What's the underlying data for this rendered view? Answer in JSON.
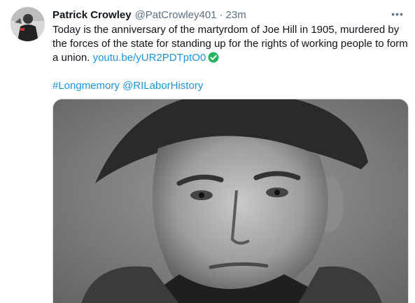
{
  "tweet": {
    "author_name": "Patrick Crowley",
    "handle": "@PatCrowley401",
    "separator": "·",
    "time": "23m",
    "more_label": "•••",
    "text": "Today is the anniversary of the martyrdom of Joe Hill in 1905, murdered by the forces of the state for standing up for the rights of working people to form a union.",
    "link": "youtu.be/yUR2PDTptO0",
    "hashtag": "#Longmemory",
    "mention": "@RILaborHistory",
    "icons": {
      "avatar": "avatar",
      "more": "more-icon",
      "check": "check-circle-icon"
    },
    "colors": {
      "link": "#1b95e0",
      "secondary": "#5b7083",
      "check_green": "#22b35e"
    }
  }
}
